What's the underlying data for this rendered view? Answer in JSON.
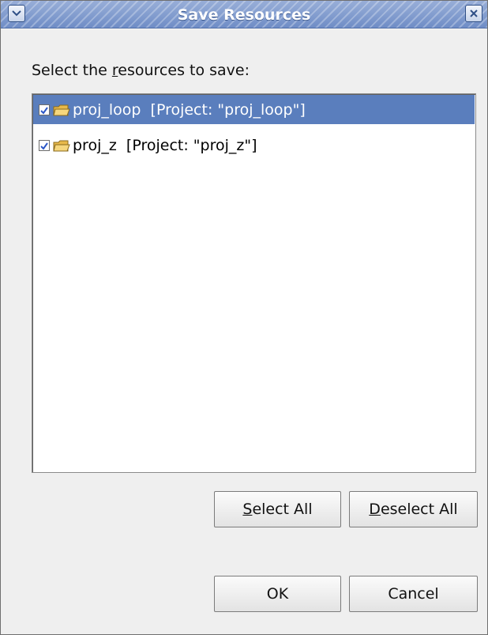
{
  "window": {
    "title": "Save Resources"
  },
  "prompt": {
    "before": "Select the ",
    "mnemonic": "r",
    "after": "esources to save:"
  },
  "resources": [
    {
      "name": "proj_loop",
      "detail": "  [Project: \"proj_loop\"]",
      "checked": true,
      "selected": true
    },
    {
      "name": "proj_z",
      "detail": "  [Project: \"proj_z\"]",
      "checked": true,
      "selected": false
    }
  ],
  "buttons": {
    "select_all": {
      "mnemonic": "S",
      "rest": "elect All"
    },
    "deselect_all": {
      "mnemonic": "D",
      "rest": "eselect All"
    },
    "ok": "OK",
    "cancel": "Cancel"
  },
  "colors": {
    "titlebar": "#7f98cf",
    "selection": "#5a7ebd",
    "check": "#2a56c6",
    "folder": "#f3c95b"
  }
}
